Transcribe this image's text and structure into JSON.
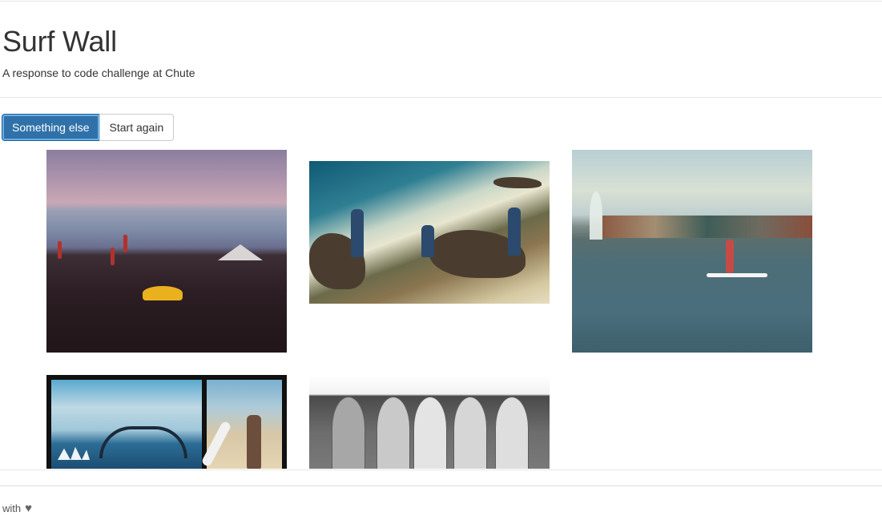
{
  "header": {
    "title": "Surf Wall",
    "subtitle": "A response to code challenge at Chute"
  },
  "toolbar": {
    "primary_label": "Something else",
    "secondary_label": "Start again"
  },
  "colors": {
    "primary": "#3071a9",
    "primary_border": "#285e8e",
    "text": "#333333",
    "rule": "#e6e6e6"
  },
  "photos": [
    {
      "alt": "beach-sunset-umbrellas-icon"
    },
    {
      "alt": "rocky-coast-friends-icon"
    },
    {
      "alt": "lake-paddleboard-city-icon"
    },
    {
      "alt": "sydney-harbour-surfer-collage-icon"
    },
    {
      "alt": "surfboards-black-white-icon"
    }
  ],
  "footer": {
    "text": "with",
    "heart_icon": "heart-icon",
    "heart_glyph": "♥"
  }
}
